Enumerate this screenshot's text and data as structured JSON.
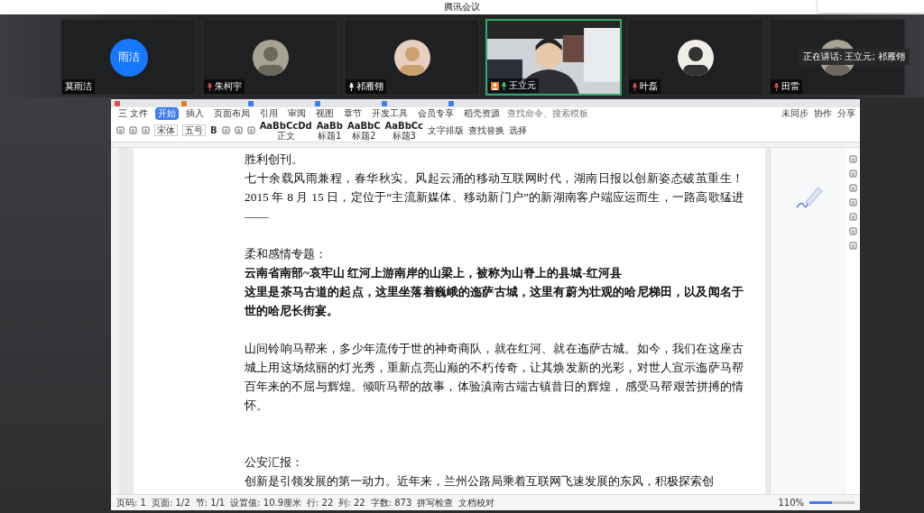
{
  "window": {
    "title": "腾讯会议"
  },
  "participants": [
    {
      "name": "莫雨洁",
      "kind": "initials",
      "initials": "雨洁",
      "active": false
    },
    {
      "name": "朱柯宇",
      "kind": "avatar",
      "muted": true,
      "speaking": false,
      "active": false
    },
    {
      "name": "祁雁翎",
      "kind": "avatar",
      "muted": false,
      "speaking": false,
      "active": false
    },
    {
      "name": "王立元",
      "kind": "video",
      "muted": false,
      "speaking": true,
      "host": true,
      "active": true
    },
    {
      "name": "叶磊",
      "kind": "avatar",
      "muted": true,
      "speaking": false,
      "active": false
    },
    {
      "name": "田雷",
      "kind": "avatar",
      "muted": true,
      "speaking": false,
      "active": false
    }
  ],
  "speaking_tip": "正在讲话: 王立元; 祁雁翎",
  "editor": {
    "menu": [
      {
        "label": "三 文件",
        "selected": false
      },
      {
        "label": "开始",
        "selected": true
      },
      {
        "label": "插入",
        "selected": false
      },
      {
        "label": "页面布局",
        "selected": false
      },
      {
        "label": "引用",
        "selected": false
      },
      {
        "label": "审阅",
        "selected": false
      },
      {
        "label": "视图",
        "selected": false
      },
      {
        "label": "章节",
        "selected": false
      },
      {
        "label": "开发工具",
        "selected": false
      },
      {
        "label": "会员专享",
        "selected": false
      },
      {
        "label": "稻壳资源",
        "selected": false
      }
    ],
    "search": {
      "placeholder": "查找命令、搜索模板"
    },
    "top_actions": [
      "未同步",
      "协作",
      "分享"
    ],
    "font": "宋体",
    "size": "五号",
    "bold_key": "B",
    "styles": [
      {
        "preview": "AaBbCcDd",
        "label": "正文"
      },
      {
        "preview": "AaBb",
        "label": "标题1"
      },
      {
        "preview": "AaBbC",
        "label": "标题2"
      },
      {
        "preview": "AaBbCc",
        "label": "标题3"
      }
    ],
    "tools": [
      "文字排版",
      "查找替换",
      "选择"
    ],
    "document": [
      {
        "kind": "text",
        "text": "胜利创刊。",
        "bold": false
      },
      {
        "kind": "text",
        "text": "七十余载风雨兼程，春华秋实。风起云涌的移动互联网时代，湖南日报以创新姿态破茧重生！2015 年 8 月 15 日，定位于“主流新媒体、移动新门户”的新湖南客户端应运而生，一路高歌猛进——",
        "bold": false
      },
      {
        "kind": "blank"
      },
      {
        "kind": "text",
        "text": "柔和感情专题：",
        "bold": false
      },
      {
        "kind": "text",
        "text": "云南省南部~哀牢山  红河上游南岸的山梁上，被称为山脊上的县城-红河县",
        "bold": true
      },
      {
        "kind": "text",
        "text": "这里是茶马古道的起点，这里坐落着巍峨的迤萨古城，这里有蔚为壮观的哈尼梯田，以及闻名于世的哈尼长街宴。",
        "bold": true
      },
      {
        "kind": "blank"
      },
      {
        "kind": "text",
        "text": "山间铃响马帮来，多少年流传于世的神奇商队，就在红河、就在迤萨古城。如今，我们在这座古城上用这场炫丽的灯光秀，重新点亮山巅的不朽传奇，让其焕发新的光彩，对世人宣示迤萨马帮百年来的不屈与辉煌。倾听马帮的故事，体验滇南古端古镇昔日的辉煌，  感受马帮艰苦拼搏的情怀。",
        "bold": false
      },
      {
        "kind": "blank"
      },
      {
        "kind": "blank"
      },
      {
        "kind": "text",
        "text": "公安汇报：",
        "bold": false
      },
      {
        "kind": "text",
        "text": "创新是引领发展的第一动力。近年来，兰州公路局乘着互联网飞速发展的东风，积极探索创",
        "bold": false
      }
    ],
    "status": [
      "页码: 1",
      "页面: 1/2",
      "节: 1/1",
      "设置值: 10.9厘米",
      "行: 22",
      "列: 22",
      "字数: 873",
      "拼写检查",
      "文档校对"
    ],
    "zoom": "110%",
    "zoom_slider": {
      "level": 0.5
    }
  }
}
